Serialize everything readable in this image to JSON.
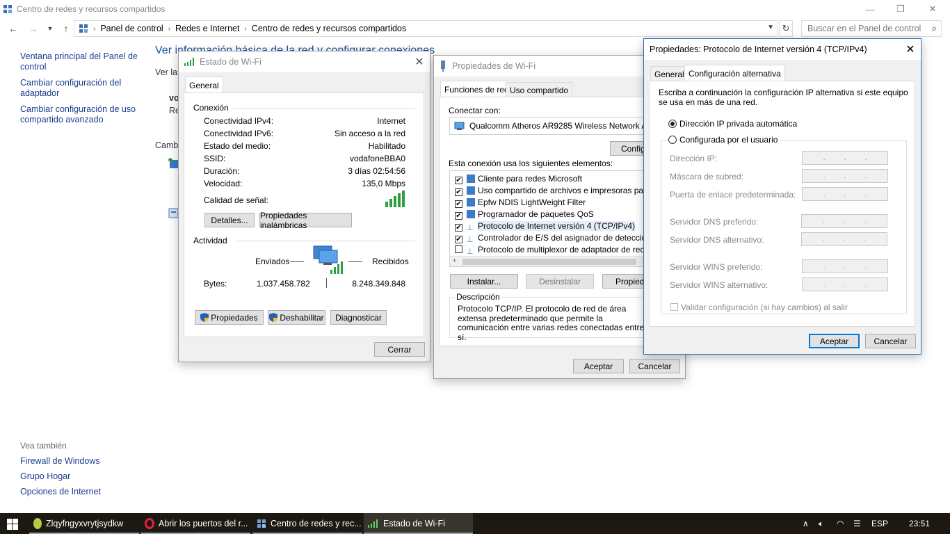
{
  "window": {
    "title": "Centro de redes y recursos compartidos",
    "minimize_glyph": "—",
    "maximize_glyph": "❐",
    "close_glyph": "✕"
  },
  "address": {
    "crumbs": [
      "Panel de control",
      "Redes e Internet",
      "Centro de redes y recursos compartidos"
    ],
    "search_placeholder": "Buscar en el Panel de control"
  },
  "left_nav": {
    "items": [
      "Ventana principal del Panel de control",
      "Cambiar configuración del adaptador",
      "Cambiar configuración de uso compartido avanzado"
    ],
    "see_also_header": "Vea también",
    "see_also": [
      "Firewall de Windows",
      "Grupo Hogar",
      "Opciones de Internet"
    ]
  },
  "main": {
    "heading": "Ver información básica de la red y configurar conexiones",
    "frag_ver": "Ver las",
    "frag_vo": "vo",
    "frag_re": "Re",
    "frag_cambi": "Cambi"
  },
  "status_dialog": {
    "title": "Estado de Wi-Fi",
    "tab": "General",
    "conexion_header": "Conexión",
    "rows": [
      {
        "label": "Conectividad IPv4:",
        "value": "Internet"
      },
      {
        "label": "Conectividad IPv6:",
        "value": "Sin acceso a la red"
      },
      {
        "label": "Estado del medio:",
        "value": "Habilitado"
      },
      {
        "label": "SSID:",
        "value": "vodafoneBBA0"
      },
      {
        "label": "Duración:",
        "value": "3 días 02:54:56"
      },
      {
        "label": "Velocidad:",
        "value": "135,0 Mbps"
      }
    ],
    "signal_label": "Calidad de señal:",
    "btn_details": "Detalles...",
    "btn_wireless": "Propiedades inalámbricas",
    "activity_header": "Actividad",
    "sent_label": "Enviados",
    "received_label": "Recibidos",
    "bytes_label": "Bytes:",
    "bytes_sent": "1.037.458.782",
    "bytes_received": "8.248.349.848",
    "btn_properties": "Propiedades",
    "btn_disable": "Deshabilitar",
    "btn_diagnose": "Diagnosticar",
    "btn_close": "Cerrar"
  },
  "props_dialog": {
    "title": "Propiedades de Wi-Fi",
    "tab_network": "Funciones de red",
    "tab_sharing": "Uso compartido",
    "connect_using": "Conectar con:",
    "adapter": "Qualcomm Atheros AR9285 Wireless Network Adapter",
    "btn_configure": "Configurar...",
    "items_label": "Esta conexión usa los siguientes elementos:",
    "items": [
      {
        "label": "Cliente para redes Microsoft",
        "checked": "✔"
      },
      {
        "label": "Uso compartido de archivos e impresoras para redes Microsoft",
        "checked": "✔"
      },
      {
        "label": "Epfw NDIS LightWeight Filter",
        "checked": "✔"
      },
      {
        "label": "Programador de paquetes QoS",
        "checked": "✔"
      },
      {
        "label": "Protocolo de Internet versión 4 (TCP/IPv4)",
        "checked": "✔"
      },
      {
        "label": "Controlador de E/S del asignador de detección de topologías",
        "checked": "✔"
      },
      {
        "label": "Protocolo de multiplexor de adaptador de red de Microsoft",
        "checked": ""
      }
    ],
    "btn_install": "Instalar...",
    "btn_uninstall": "Desinstalar",
    "btn_properties": "Propiedades",
    "desc_header": "Descripción",
    "description": "Protocolo TCP/IP. El protocolo de red de área extensa predeterminado que permite la comunicación entre varias redes conectadas entre sí.",
    "btn_ok": "Aceptar",
    "btn_cancel": "Cancelar"
  },
  "ipv4_dialog": {
    "title": "Propiedades: Protocolo de Internet versión 4 (TCP/IPv4)",
    "tab_general": "General",
    "tab_alt": "Configuración alternativa",
    "intro": "Escriba a continuación la configuración IP alternativa si este equipo se usa en más de una red.",
    "radio_auto": "Dirección IP privada automática",
    "radio_user": "Configurada por el usuario",
    "fields": [
      "Dirección IP:",
      "Máscara de subred:",
      "Puerta de enlace predeterminada:",
      "Servidor DNS preferido:",
      "Servidor DNS alternativo:",
      "Servidor WINS preferido:",
      "Servidor WINS alternativo:"
    ],
    "validate": "Validar configuración (si hay cambios) al salir",
    "btn_ok": "Aceptar",
    "btn_cancel": "Cancelar"
  },
  "taskbar": {
    "items": [
      "Zlqyfngyxvrytjsydkw",
      "Abrir los puertos del r...",
      "Centro de redes y rec...",
      "Estado de Wi-Fi"
    ],
    "lang": "ESP",
    "time": "23:51"
  },
  "colors": {
    "link": "#1a3d8f",
    "heading": "#1e4f9c",
    "accent": "#0078d7",
    "taskbar": "#1d1912"
  }
}
